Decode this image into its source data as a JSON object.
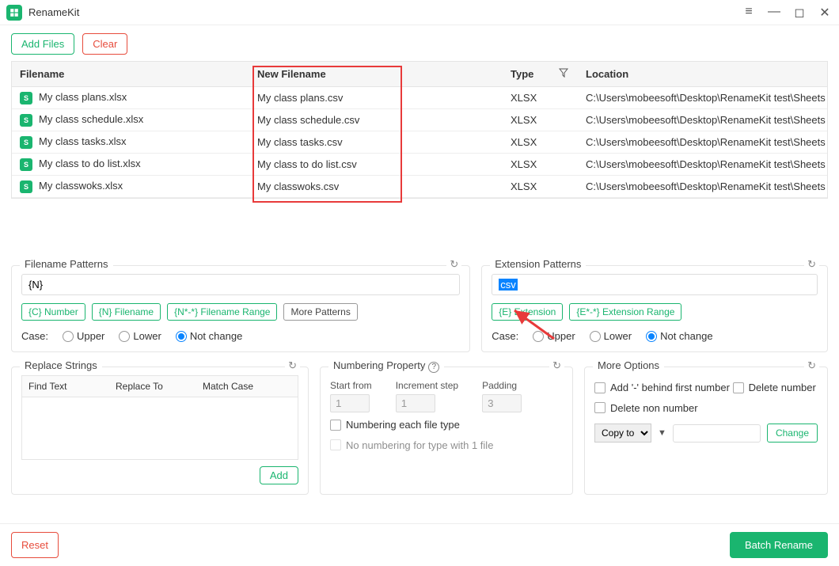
{
  "app": {
    "title": "RenameKit"
  },
  "toolbar": {
    "add_files": "Add Files",
    "clear": "Clear"
  },
  "table": {
    "headers": {
      "filename": "Filename",
      "new_filename": "New Filename",
      "type": "Type",
      "location": "Location"
    },
    "rows": [
      {
        "filename": "My class plans.xlsx",
        "new_filename": "My class plans.csv",
        "type": "XLSX",
        "location": "C:\\Users\\mobeesoft\\Desktop\\RenameKit test\\Sheets"
      },
      {
        "filename": "My class schedule.xlsx",
        "new_filename": "My class schedule.csv",
        "type": "XLSX",
        "location": "C:\\Users\\mobeesoft\\Desktop\\RenameKit test\\Sheets"
      },
      {
        "filename": "My class tasks.xlsx",
        "new_filename": "My class tasks.csv",
        "type": "XLSX",
        "location": "C:\\Users\\mobeesoft\\Desktop\\RenameKit test\\Sheets"
      },
      {
        "filename": "My class to do list.xlsx",
        "new_filename": "My class to do list.csv",
        "type": "XLSX",
        "location": "C:\\Users\\mobeesoft\\Desktop\\RenameKit test\\Sheets"
      },
      {
        "filename": "My classwoks.xlsx",
        "new_filename": "My classwoks.csv",
        "type": "XLSX",
        "location": "C:\\Users\\mobeesoft\\Desktop\\RenameKit test\\Sheets"
      }
    ]
  },
  "filename_patterns": {
    "title": "Filename Patterns",
    "value": "{N}",
    "chips": {
      "c_number": "{C} Number",
      "n_filename": "{N} Filename",
      "filename_range": "{N*-*} Filename Range",
      "more": "More Patterns"
    },
    "case_label": "Case:",
    "case_upper": "Upper",
    "case_lower": "Lower",
    "case_notchange": "Not change"
  },
  "extension_patterns": {
    "title": "Extension Patterns",
    "value": "csv",
    "chips": {
      "e_extension": "{E} Extension",
      "extension_range": "{E*-*} Extension Range"
    },
    "case_label": "Case:",
    "case_upper": "Upper",
    "case_lower": "Lower",
    "case_notchange": "Not change"
  },
  "replace": {
    "title": "Replace Strings",
    "headers": {
      "find": "Find Text",
      "replace": "Replace To",
      "match": "Match Case"
    },
    "add": "Add"
  },
  "numbering": {
    "title": "Numbering Property",
    "start_from_label": "Start from",
    "start_from": "1",
    "increment_label": "Increment step",
    "increment": "1",
    "padding_label": "Padding",
    "padding": "3",
    "each_filetype": "Numbering each file type",
    "no_numbering_single": "No numbering for type with 1 file"
  },
  "more_options": {
    "title": "More Options",
    "add_dash": "Add '-' behind first number",
    "delete_number": "Delete number",
    "delete_non_number": "Delete non number",
    "copy_to": "Copy to",
    "change": "Change"
  },
  "footer": {
    "reset": "Reset",
    "batch_rename": "Batch Rename"
  }
}
